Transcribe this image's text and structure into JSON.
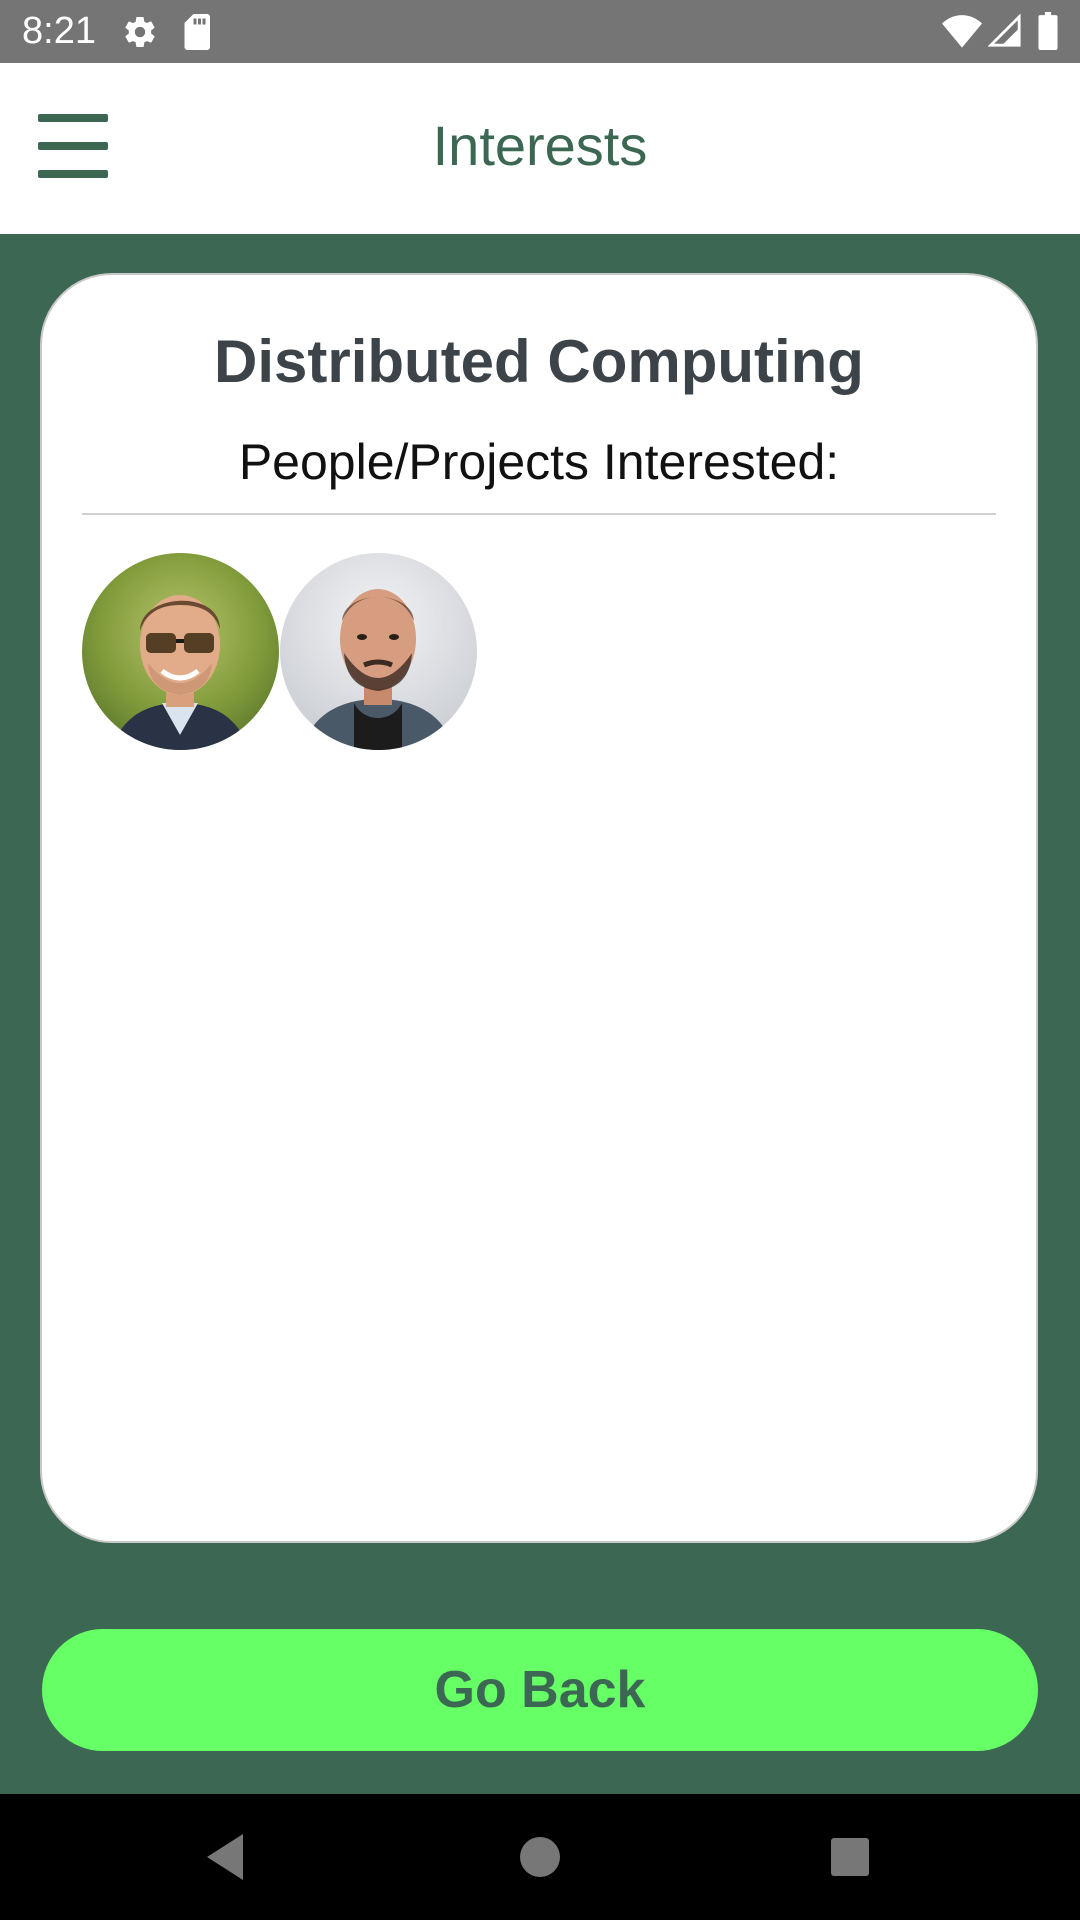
{
  "status_bar": {
    "time": "8:21",
    "icons_left": [
      "gear-icon",
      "sd-card-icon"
    ],
    "icons_right": [
      "wifi-icon",
      "signal-icon",
      "battery-icon"
    ]
  },
  "app_bar": {
    "title": "Interests",
    "menu_icon": "hamburger-menu-icon"
  },
  "card": {
    "title": "Distributed Computing",
    "subtitle": "People/Projects Interested:",
    "avatars": [
      {
        "description_icon": "avatar-person-glasses"
      },
      {
        "description_icon": "avatar-person-bald"
      }
    ]
  },
  "go_back": {
    "label": "Go Back"
  },
  "nav_bar": {
    "buttons": [
      "back-icon",
      "home-icon",
      "recents-icon"
    ]
  },
  "colors": {
    "primary": "#3b6753",
    "accent": "#66ff66",
    "status_bar": "#757575"
  }
}
